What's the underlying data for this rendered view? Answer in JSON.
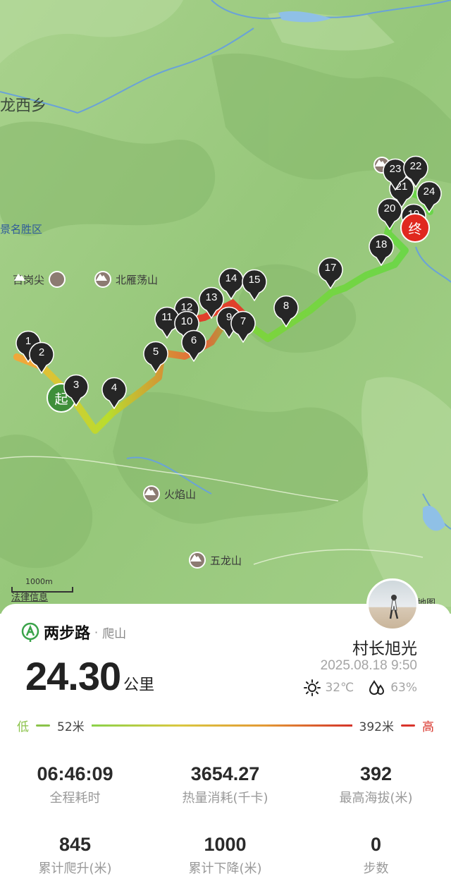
{
  "map": {
    "places": {
      "longxi": "龙西乡",
      "scenic": "景名胜区"
    },
    "pois": {
      "baigangjian": "百岗尖",
      "beiyandangshan": "北雁荡山",
      "huoyanshan": "火焰山",
      "wulongshan": "五龙山"
    },
    "markers": {
      "m1": "1",
      "m2": "2",
      "m3": "3",
      "m4": "4",
      "m5": "5",
      "m6": "6",
      "m7": "7",
      "m8": "8",
      "m9": "9",
      "m10": "10",
      "m11": "11",
      "m12": "12",
      "m13": "13",
      "m14": "14",
      "m15": "15",
      "m17": "17",
      "m18": "18",
      "m19": "19",
      "m20": "20",
      "m21": "21",
      "m22": "22",
      "m23": "23",
      "m24": "24"
    },
    "start_label": "起",
    "end_label": "终",
    "scale_label": "1000m",
    "legal_link": "法律信息",
    "watermark": "地图"
  },
  "card": {
    "brand_name": "两步路",
    "brand_dot": "·",
    "brand_sub": "爬山",
    "distance_value": "24.30",
    "distance_unit": "公里",
    "user_name": "村长旭光",
    "datetime": "2025.08.18 9:50",
    "temperature": "32℃",
    "humidity": "63%",
    "elevation": {
      "low_label": "低",
      "low_value": "52米",
      "high_value": "392米",
      "high_label": "高",
      "low_color": "#8bc34a",
      "high_color": "#d9342b"
    },
    "stats": [
      {
        "value": "06:46:09",
        "label": "全程耗时"
      },
      {
        "value": "3654.27",
        "label": "热量消耗(千卡)"
      },
      {
        "value": "392",
        "label": "最高海拔(米)"
      },
      {
        "value": "845",
        "label": "累计爬升(米)"
      },
      {
        "value": "1000",
        "label": "累计下降(米)"
      },
      {
        "value": "0",
        "label": "步数"
      }
    ]
  }
}
